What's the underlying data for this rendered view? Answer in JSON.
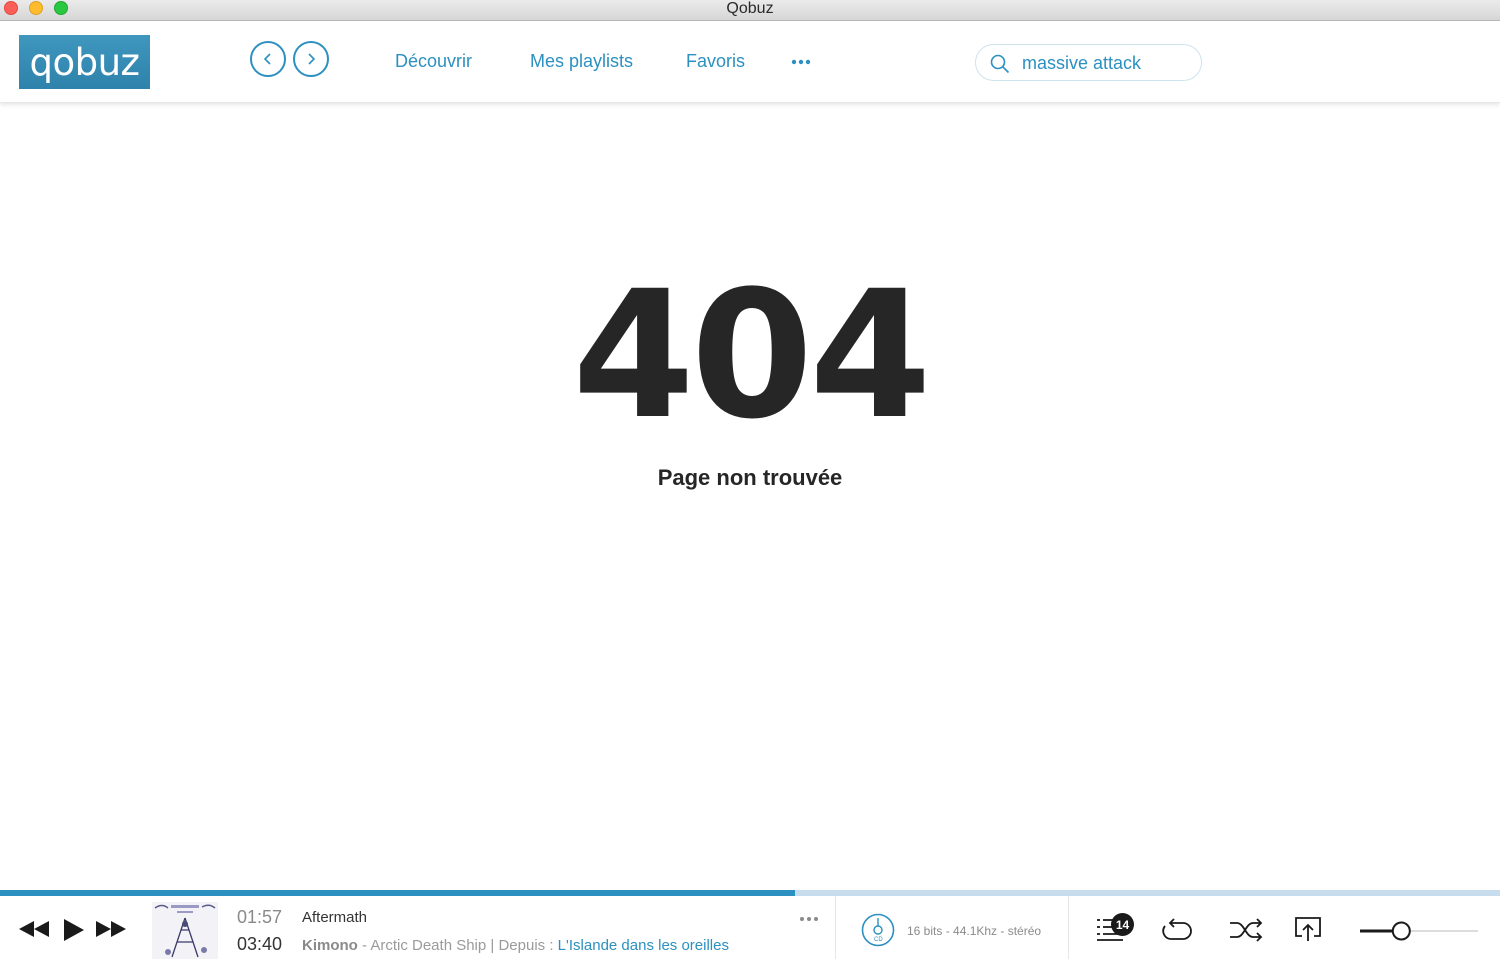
{
  "window": {
    "title": "Qobuz"
  },
  "header": {
    "logo_text": "qobuz",
    "nav": {
      "back_icon": "chevron-left-icon",
      "forward_icon": "chevron-right-icon"
    },
    "links": [
      "Découvrir",
      "Mes playlists",
      "Favoris"
    ],
    "more_icon": "more-dots-icon",
    "search": {
      "value": "massive attack",
      "icon": "search-icon"
    }
  },
  "content": {
    "error_code": "404",
    "error_message": "Page non trouvée"
  },
  "player": {
    "progress_fraction": 0.53,
    "time_elapsed": "01:57",
    "time_total": "03:40",
    "track_title": "Aftermath",
    "album": "Kimono",
    "separator": " - ",
    "artist": "Arctic Death Ship",
    "source_prefix": " | Depuis : ",
    "playlist": "L'Islande dans les oreilles",
    "quality": "16 bits - 44.1Khz - stéréo",
    "queue_count": "14",
    "volume_fraction": 0.35
  },
  "colors": {
    "accent": "#2c90c0",
    "text_dark": "#262626",
    "progress_track": "#c7dcec"
  }
}
